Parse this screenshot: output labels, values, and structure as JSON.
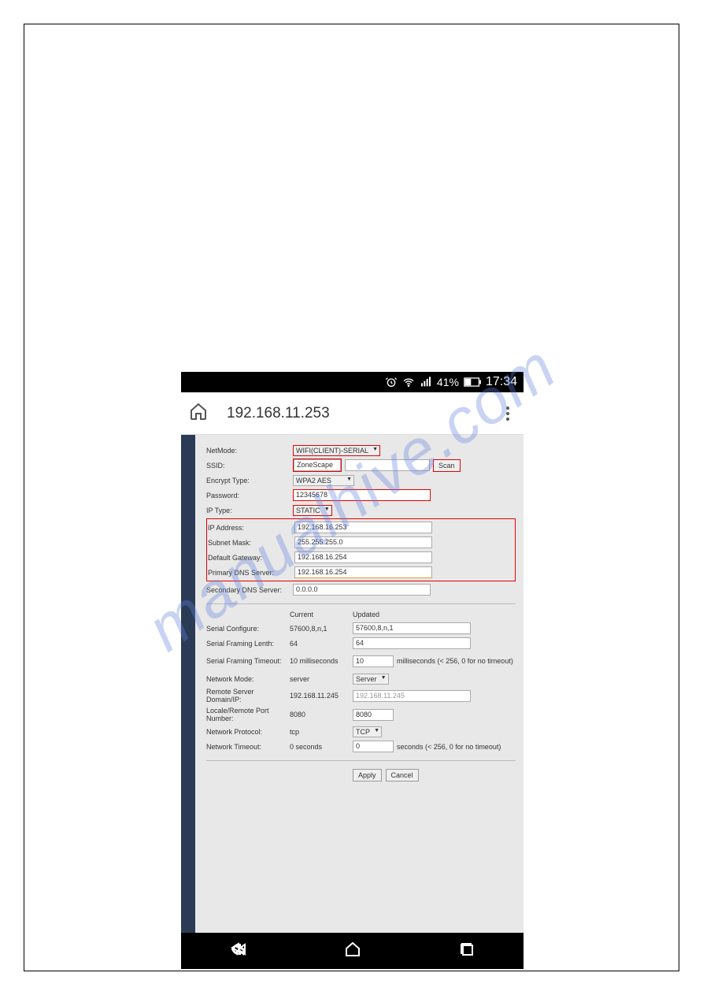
{
  "watermark": "manualhive.com",
  "statusBar": {
    "battery": "41%",
    "time": "17:34"
  },
  "url": "192.168.11.253",
  "form": {
    "netmode": {
      "label": "NetMode:",
      "value": "WIFI(CLIENT)-SERIAL"
    },
    "ssid": {
      "label": "SSID:",
      "value": "ZoneScape",
      "scanBtn": "Scan"
    },
    "encrypt": {
      "label": "Encrypt Type:",
      "value": "WPA2 AES"
    },
    "password": {
      "label": "Password:",
      "value": "12345678"
    },
    "iptype": {
      "label": "IP Type:",
      "value": "STATIC"
    },
    "ipaddr": {
      "label": "IP Address:",
      "value": "192.168.16.253"
    },
    "subnet": {
      "label": "Subnet Mask:",
      "value": "255.255.255.0"
    },
    "gateway": {
      "label": "Default Gateway:",
      "value": "192.168.16.254"
    },
    "dns1": {
      "label": "Primary DNS Server:",
      "value": "192.168.16.254"
    },
    "dns2": {
      "label": "Secondary DNS Server:",
      "value": "0.0.0.0"
    }
  },
  "tableHead": {
    "current": "Current",
    "updated": "Updated"
  },
  "serial": {
    "configure": {
      "label": "Serial Configure:",
      "current": "57600,8,n,1",
      "updated": "57600,8,n,1"
    },
    "framing": {
      "label": "Serial Framing Lenth:",
      "current": "64",
      "updated": "64"
    },
    "timeout": {
      "label": "Serial Framing Timeout:",
      "current": "10 milliseconds",
      "updated": "10",
      "suffix": "milliseconds (< 256, 0 for no timeout)"
    },
    "netmode": {
      "label": "Network Mode:",
      "current": "server",
      "updated": "Server"
    },
    "remote": {
      "label": "Remote Server Domain/IP:",
      "current": "192.168.11.245",
      "updated": "192.168.11.245"
    },
    "port": {
      "label": "Locale/Remote Port Number:",
      "current": "8080",
      "updated": "8080"
    },
    "protocol": {
      "label": "Network Protocol:",
      "current": "tcp",
      "updated": "TCP"
    },
    "nettimeout": {
      "label": "Network Timeout:",
      "current": "0 seconds",
      "updated": "0",
      "suffix": "seconds (< 256, 0 for no timeout)"
    }
  },
  "buttons": {
    "apply": "Apply",
    "cancel": "Cancel"
  }
}
